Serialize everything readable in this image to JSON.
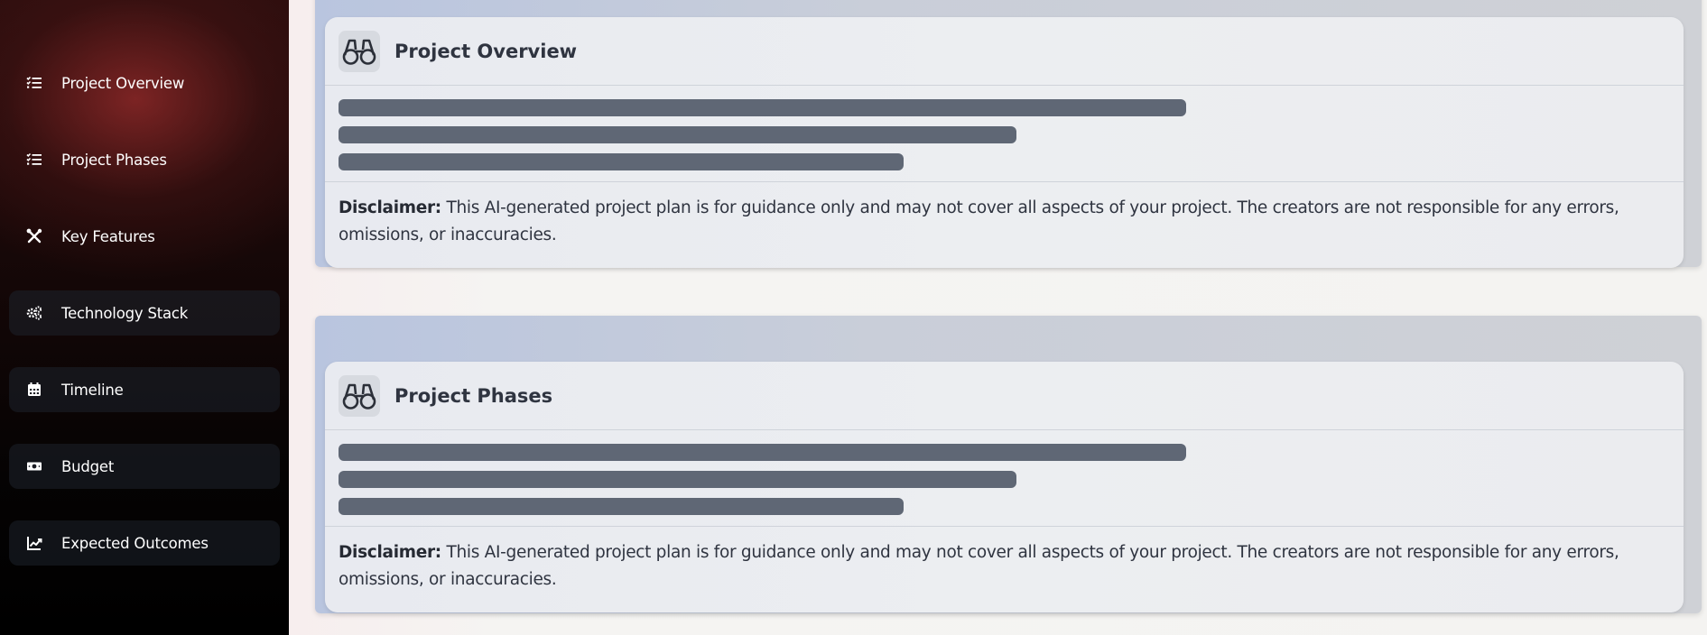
{
  "sidebar": {
    "items": [
      {
        "label": "Project Overview",
        "icon": "checklist-icon"
      },
      {
        "label": "Project Phases",
        "icon": "checklist-icon"
      },
      {
        "label": "Key Features",
        "icon": "tools-icon"
      },
      {
        "label": "Technology Stack",
        "icon": "gears-icon"
      },
      {
        "label": "Timeline",
        "icon": "calendar-icon"
      },
      {
        "label": "Budget",
        "icon": "money-icon"
      },
      {
        "label": "Expected Outcomes",
        "icon": "chart-line-icon"
      }
    ]
  },
  "sections": [
    {
      "title": "Project Overview",
      "icon": "binoculars-icon",
      "disclaimer_label": "Disclaimer:",
      "disclaimer_text": "This AI-generated project plan is for guidance only and may not cover all aspects of your project. The creators are not responsible for any errors, omissions, or inaccuracies."
    },
    {
      "title": "Project Phases",
      "icon": "binoculars-icon",
      "disclaimer_label": "Disclaimer:",
      "disclaimer_text": "This AI-generated project plan is for guidance only and may not cover all aspects of your project. The creators are not responsible for any errors, omissions, or inaccuracies."
    }
  ],
  "colors": {
    "sidebar_bg": "#000000",
    "sidebar_glow": "#8c2828",
    "skeleton_bar": "#5f6775",
    "card_bg": "#eceef1",
    "section_bg": "#c9ced9",
    "text": "#2f3440"
  }
}
